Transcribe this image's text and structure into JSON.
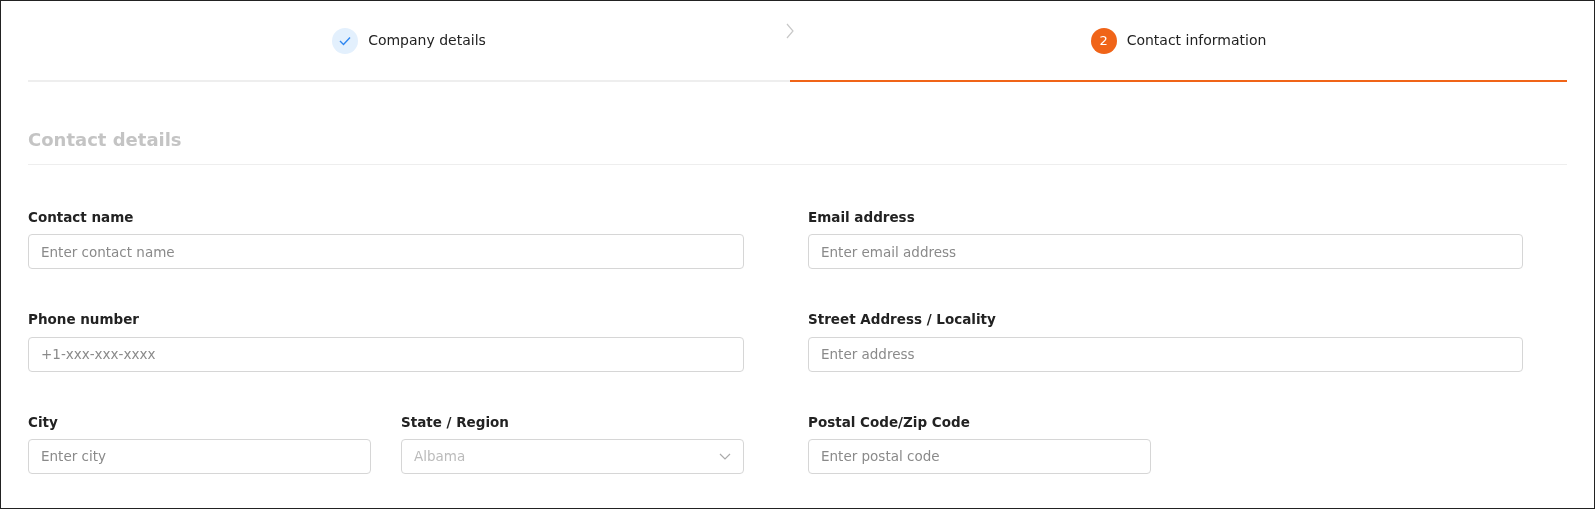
{
  "steps": [
    {
      "label": "Company details",
      "completed": true,
      "selected": false
    },
    {
      "label": "Contact information",
      "number": "2",
      "completed": false,
      "selected": true
    }
  ],
  "section_title": "Contact details",
  "rows": [
    {
      "left": [
        {
          "label": "Contact name",
          "placeholder": "Enter contact name",
          "kind": "text"
        }
      ],
      "right": [
        {
          "label": "Email address",
          "placeholder": "Enter email address",
          "kind": "text"
        }
      ]
    },
    {
      "left": [
        {
          "label": "Phone number",
          "placeholder": "+1-xxx-xxx-xxxx",
          "kind": "text"
        }
      ],
      "right": [
        {
          "label": "Street Address / Locality",
          "placeholder": "Enter address",
          "kind": "text"
        }
      ]
    },
    {
      "left": [
        {
          "label": "City",
          "placeholder": "Enter city",
          "kind": "text"
        },
        {
          "label": "State / Region",
          "placeholder": "Albama",
          "kind": "select"
        }
      ],
      "right": [
        {
          "label": "Postal Code/Zip Code",
          "placeholder": "Enter postal code",
          "kind": "text"
        }
      ]
    }
  ]
}
